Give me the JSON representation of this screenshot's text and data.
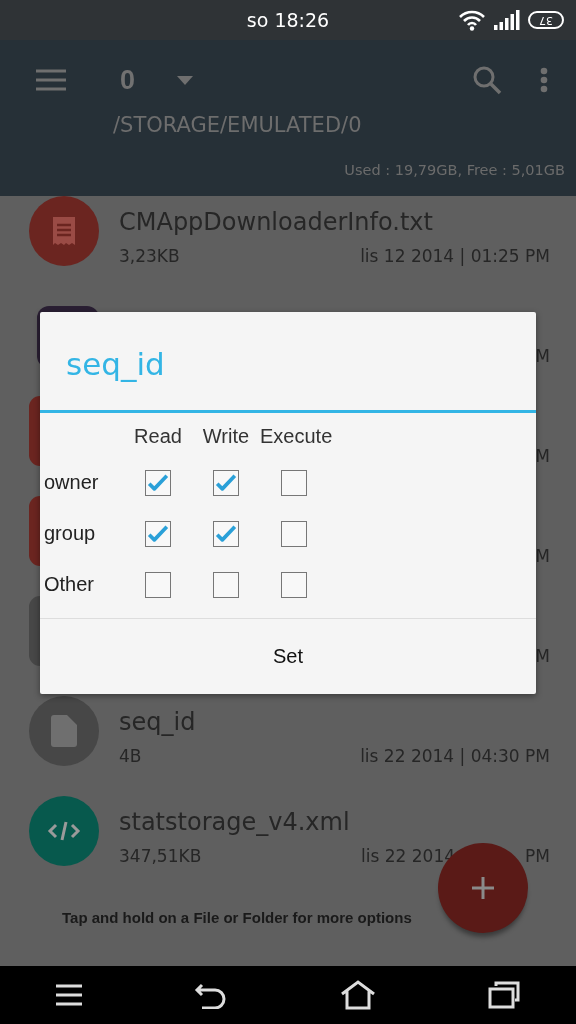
{
  "status_bar": {
    "time": "so 18:26",
    "battery": "37"
  },
  "toolbar": {
    "title": "0",
    "path": "/STORAGE/EMULATED/0",
    "storage": "Used : 19,79GB, Free : 5,01GB"
  },
  "files": [
    {
      "kind": "text",
      "color": "#6b2520",
      "name": "CMAppDownloaderInfo.txt",
      "size": "3,23KB",
      "date": "lis 12 2014 | 01:25 PM"
    },
    {
      "kind": "apk",
      "color": "#2a1f33",
      "date": "M"
    },
    {
      "kind": "circle",
      "color": "#6b2520",
      "date": "M"
    },
    {
      "kind": "circle",
      "color": "#6b2520",
      "date": "M"
    },
    {
      "kind": "circle",
      "color": "#474747",
      "date": "M"
    },
    {
      "kind": "file",
      "color": "#474747",
      "name": "seq_id",
      "size": "4B",
      "date": "lis 22 2014 | 04:30 PM"
    },
    {
      "kind": "code",
      "color": "#07594d",
      "name": "statstorage_v4.xml",
      "size": "347,51KB",
      "date": "lis 22 2014",
      "date_end": "PM"
    }
  ],
  "hint": "Tap and hold on a File or Folder for more options",
  "dialog": {
    "title": "seq_id",
    "columns": [
      "Read",
      "Write",
      "Execute"
    ],
    "rows": [
      {
        "label": "owner",
        "checks": [
          {
            "checked": true
          },
          {
            "checked": true
          },
          {
            "checked": false
          }
        ]
      },
      {
        "label": "group",
        "checks": [
          {
            "checked": true
          },
          {
            "checked": true
          },
          {
            "checked": false
          }
        ]
      },
      {
        "label": "Other",
        "checks": [
          {
            "checked": false
          },
          {
            "checked": false
          },
          {
            "checked": false
          }
        ]
      }
    ],
    "button": "Set"
  }
}
